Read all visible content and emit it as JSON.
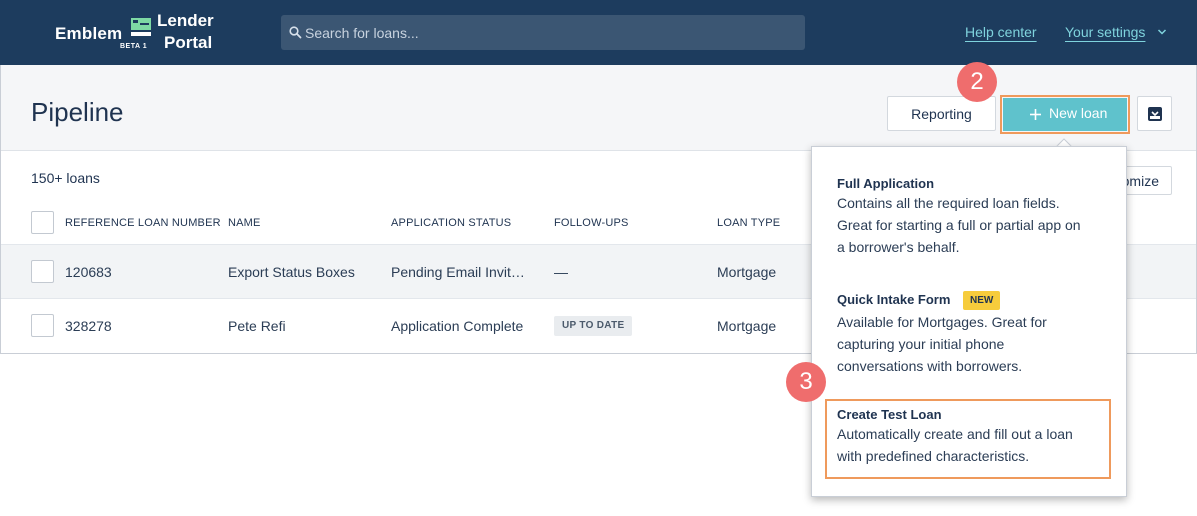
{
  "header": {
    "logo": {
      "brand": "Emblem",
      "beta": "BETA 1",
      "line1": "Lender",
      "line2": "Portal"
    },
    "search_placeholder": "Search for loans...",
    "help_label": "Help center",
    "settings_label": "Your settings"
  },
  "page": {
    "title": "Pipeline",
    "reporting_label": "Reporting",
    "new_loan_label": "New loan",
    "loan_count": "150+ loans",
    "customize_label": "omize"
  },
  "table": {
    "columns": [
      "REFERENCE LOAN NUMBER",
      "NAME",
      "APPLICATION STATUS",
      "FOLLOW-UPS",
      "LOAN TYPE"
    ],
    "rows": [
      {
        "ref": "120683",
        "name": "Export Status Boxes",
        "status": "Pending Email Invitation",
        "followups": "—",
        "type": "Mortgage"
      },
      {
        "ref": "328278",
        "name": "Pete Refi",
        "status": "Application Complete",
        "followups": "UP TO DATE",
        "type": "Mortgage"
      }
    ]
  },
  "dropdown": {
    "options": [
      {
        "title": "Full Application",
        "lines": [
          "Contains all the required loan fields.",
          "Great for starting a full or partial app on",
          "a borrower's behalf."
        ]
      },
      {
        "title": "Quick Intake Form",
        "badge": "NEW",
        "lines": [
          "Available for Mortgages. Great for",
          "capturing your initial phone",
          "conversations with borrowers."
        ]
      },
      {
        "title": "Create Test Loan",
        "lines": [
          "Automatically create and fill out a loan",
          "with predefined characteristics."
        ]
      }
    ]
  },
  "annotations": {
    "step_2": "2",
    "step_3": "3"
  },
  "colors": {
    "topbar": "#1d3c5e",
    "accent": "#5fc2cc",
    "link": "#7fd3dd",
    "highlight": "#ef9a5c",
    "step_badge": "#ef6d6d",
    "new_badge": "#f6cc3c"
  }
}
